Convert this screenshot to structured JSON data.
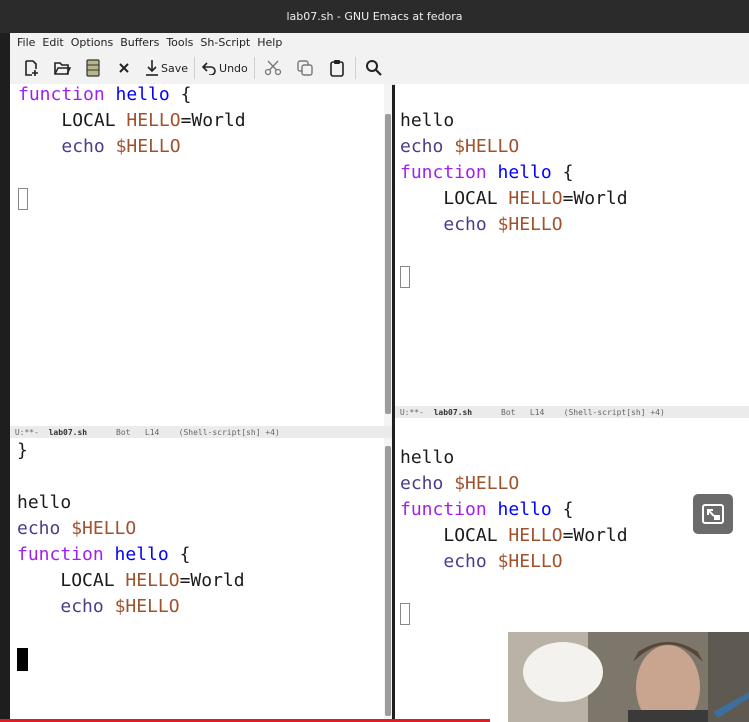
{
  "window": {
    "title": "lab07.sh - GNU Emacs at fedora"
  },
  "menu": [
    "File",
    "Edit",
    "Options",
    "Buffers",
    "Tools",
    "Sh-Script",
    "Help"
  ],
  "toolbar": {
    "save_label": "Save",
    "undo_label": "Undo"
  },
  "code": {
    "function_kw": "function",
    "func_name": "hello",
    "brace_open": "{",
    "brace_close": "}",
    "local_kw": "LOCAL",
    "var_name": "HELLO",
    "assign_value": "=World",
    "echo_kw": "echo",
    "var_ref": "$HELLO",
    "plain_hello": "hello"
  },
  "modeline": {
    "status": "U:**-",
    "buffer": "lab07.sh",
    "position": "Bot",
    "line": "L14",
    "mode": "(Shell-script[sh] +4)"
  },
  "colors": {
    "keyword": "#a020f0",
    "function_name": "#0000ff",
    "variable": "#a0522d",
    "builtin": "#483d8b"
  }
}
